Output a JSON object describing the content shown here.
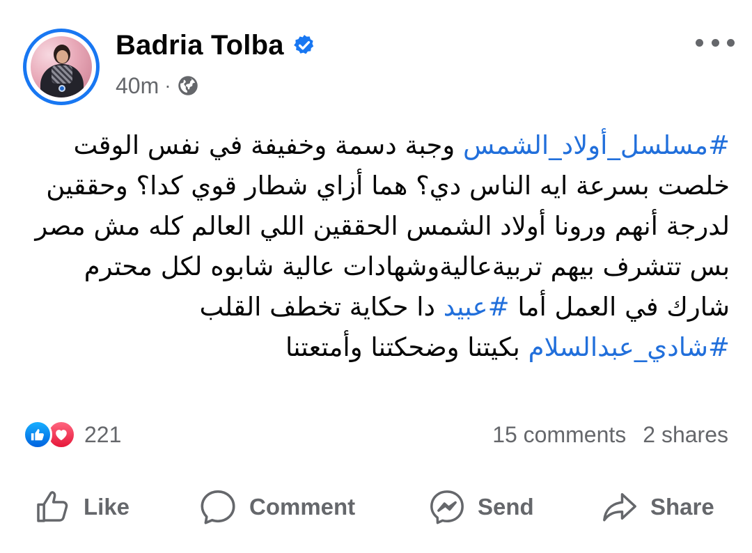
{
  "author": {
    "name": "Badria Tolba",
    "verified": true,
    "time": "40m",
    "separator": "·",
    "audience_icon": "globe-icon"
  },
  "more_icon": "more-horizontal-icon",
  "post": {
    "lines": [
      [
        {
          "text": "#مسلسل_أولاد_الشمس",
          "type": "hashtag"
        },
        {
          "text": " وجبة دسمة وخفيفة في نفس الوقت",
          "type": "text"
        }
      ],
      [
        {
          "text": "خلصت بسرعة ايه الناس دي؟ هما أزاي شطار قوي كدا؟ وحققين",
          "type": "text"
        }
      ],
      [
        {
          "text": "لدرجة أنهم ورونا أولاد الشمس الحققين اللي العالم كله مش مصر",
          "type": "text"
        }
      ],
      [
        {
          "text": "بس تتشرف بيهم تربيةعاليةوشهادات عالية شابوه لكل محترم",
          "type": "text"
        }
      ],
      [
        {
          "text": "شارك في العمل أما ",
          "type": "text"
        },
        {
          "text": "#عبيد",
          "type": "hashtag"
        },
        {
          "text": " دا حكاية تخطف القلب",
          "type": "text"
        }
      ],
      [
        {
          "text": "#شادي_عبدالسلام",
          "type": "hashtag"
        },
        {
          "text": " بكيتنا وضحكتنا وأمتعتنا",
          "type": "text"
        }
      ]
    ]
  },
  "reactions": {
    "icons": [
      "like-reaction-icon",
      "love-reaction-icon"
    ],
    "count": "221"
  },
  "stats": {
    "comments": "15 comments",
    "shares": "2 shares"
  },
  "actions": {
    "like": "Like",
    "comment": "Comment",
    "send": "Send",
    "share": "Share"
  },
  "colors": {
    "accent": "#1877f2",
    "hashtag": "#216fdb",
    "muted": "#65676b",
    "text": "#050505"
  }
}
